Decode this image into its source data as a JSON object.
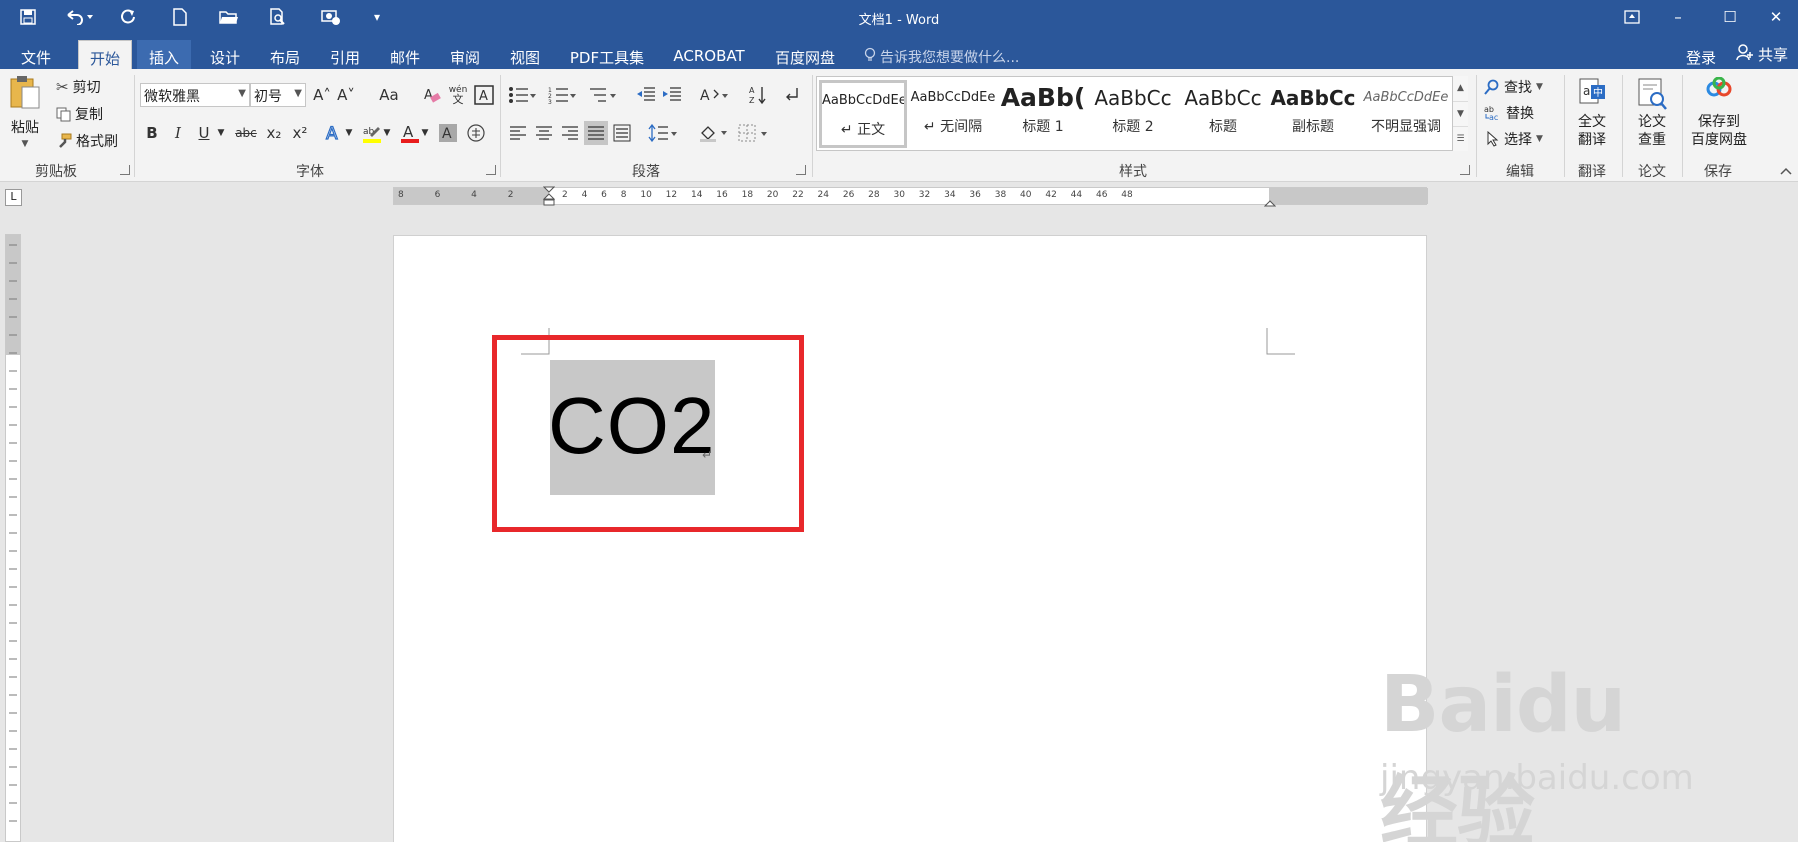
{
  "window": {
    "title": "文档1 - Word",
    "minimize": "–",
    "maximize": "☐",
    "close": "✕"
  },
  "quick_access": {
    "save_icon": "save-icon",
    "undo_icon": "undo-icon",
    "redo_icon": "redo-icon",
    "customize": "▾"
  },
  "tabs": [
    {
      "label": "文件"
    },
    {
      "label": "开始"
    },
    {
      "label": "插入"
    },
    {
      "label": "设计"
    },
    {
      "label": "布局"
    },
    {
      "label": "引用"
    },
    {
      "label": "邮件"
    },
    {
      "label": "审阅"
    },
    {
      "label": "视图"
    },
    {
      "label": "PDF工具集"
    },
    {
      "label": "ACROBAT"
    },
    {
      "label": "百度网盘"
    }
  ],
  "tell_me": "告诉我您想要做什么...",
  "account": {
    "login": "登录",
    "share": "共享"
  },
  "clipboard": {
    "paste": "粘贴",
    "cut": "剪切",
    "copy": "复制",
    "format_painter": "格式刷",
    "label": "剪贴板"
  },
  "font": {
    "name": "微软雅黑",
    "size": "初号",
    "label": "字体",
    "bold": "B",
    "italic": "I",
    "underline": "U",
    "strike": "abc",
    "subscript": "x₂",
    "superscript": "x²",
    "change_case": "Aa",
    "grow": "A˄",
    "shrink": "A˅",
    "phonetic": "wén"
  },
  "paragraph": {
    "label": "段落"
  },
  "styles": {
    "label": "样式",
    "items": [
      {
        "preview": "AaBbCcDdEe",
        "name": "↵ 正文"
      },
      {
        "preview": "AaBbCcDdEe",
        "name": "↵ 无间隔"
      },
      {
        "preview": "AaBb(",
        "name": "标题 1"
      },
      {
        "preview": "AaBbCc",
        "name": "标题 2"
      },
      {
        "preview": "AaBbCc",
        "name": "标题"
      },
      {
        "preview": "AaBbCc",
        "name": "副标题"
      },
      {
        "preview": "AaBbCcDdEe",
        "name": "不明显强调"
      }
    ]
  },
  "editing": {
    "find": "查找",
    "replace": "替换",
    "select": "选择",
    "label": "编辑"
  },
  "translate": {
    "line1": "全文",
    "line2": "翻译",
    "label": "翻译"
  },
  "thesis": {
    "line1": "论文",
    "line2": "查重",
    "label": "论文"
  },
  "save_cloud": {
    "line1": "保存到",
    "line2": "百度网盘",
    "label": "保存"
  },
  "ruler": {
    "h_left": "8 6 4 2",
    "h_right": "2 4 6 8 10 12 14 16 18 20 22 24 26 28 30 32 34 36 38 40 42 44 46 48",
    "tab_marker": "L"
  },
  "document": {
    "text": "CO2",
    "para_mark": "↵"
  },
  "watermark": {
    "logo": "Baidu 经验",
    "url": "jingyan.baidu.com"
  },
  "colors": {
    "accent": "#2b579a",
    "ribbon_bg": "#f3f3f3",
    "highlight_box": "#e8282b",
    "selection": "#c8c8c8"
  }
}
